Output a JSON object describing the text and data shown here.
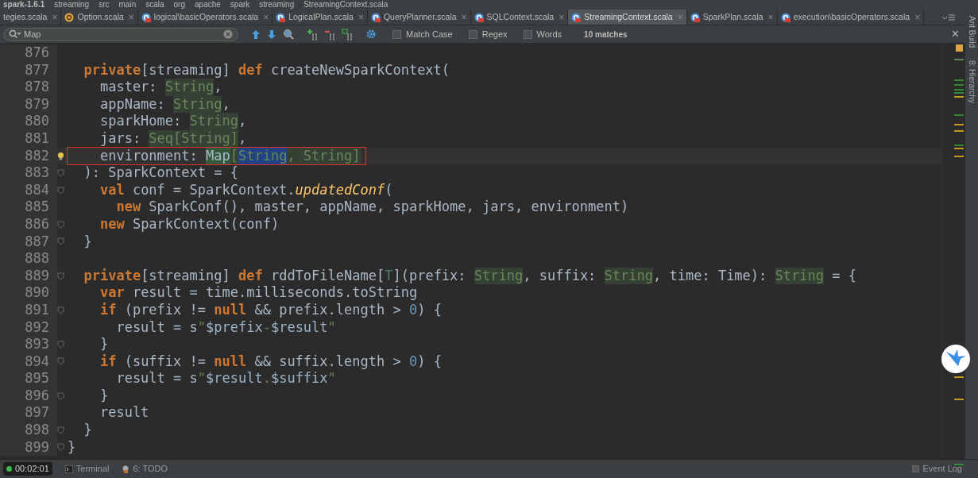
{
  "breadcrumb": [
    "spark-1.6.1",
    "streaming",
    "src",
    "main",
    "scala",
    "org",
    "apache",
    "spark",
    "streaming",
    "StreamingContext.scala"
  ],
  "tabs": [
    {
      "label": "tegies.scala",
      "kind": "plain",
      "close": "×",
      "selected": false
    },
    {
      "label": "Option.scala",
      "kind": "object",
      "close": "×",
      "selected": false
    },
    {
      "label": "logical\\basicOperators.scala",
      "kind": "class",
      "close": "×",
      "selected": false
    },
    {
      "label": "LogicalPlan.scala",
      "kind": "class",
      "close": "×",
      "selected": false
    },
    {
      "label": "QueryPlanner.scala",
      "kind": "class",
      "close": "×",
      "selected": false
    },
    {
      "label": "SQLContext.scala",
      "kind": "class",
      "close": "×",
      "selected": false
    },
    {
      "label": "StreamingContext.scala",
      "kind": "class",
      "close": "×",
      "selected": true
    },
    {
      "label": "SparkPlan.scala",
      "kind": "class",
      "close": "×",
      "selected": false
    },
    {
      "label": "execution\\basicOperators.scala",
      "kind": "class",
      "close": "×",
      "selected": false
    }
  ],
  "search": {
    "value": "Map",
    "options": [
      {
        "label": "Match Case",
        "checked": false
      },
      {
        "label": "Regex",
        "checked": false
      },
      {
        "label": "Words",
        "checked": false
      }
    ],
    "matches": "10 matches",
    "close": "×"
  },
  "lines": [
    {
      "number": "876"
    },
    {
      "number": "877",
      "tokens": [
        {
          "text": "  private",
          "kind": "keyword"
        },
        {
          "text": "[streaming] ",
          "kind": "plain"
        },
        {
          "text": "def",
          "kind": "keyword"
        },
        {
          "text": " createNewSparkContext(",
          "kind": "plain"
        }
      ]
    },
    {
      "number": "878",
      "tokens": [
        {
          "text": "    master: ",
          "kind": "plain"
        },
        {
          "text": "String",
          "kind": "usage"
        },
        {
          "text": ",",
          "kind": "plain"
        }
      ]
    },
    {
      "number": "879",
      "tokens": [
        {
          "text": "    appName: ",
          "kind": "plain"
        },
        {
          "text": "String",
          "kind": "usage"
        },
        {
          "text": ",",
          "kind": "plain"
        }
      ]
    },
    {
      "number": "880",
      "tokens": [
        {
          "text": "    sparkHome: ",
          "kind": "plain"
        },
        {
          "text": "String",
          "kind": "usage"
        },
        {
          "text": ",",
          "kind": "plain"
        }
      ]
    },
    {
      "number": "881",
      "tokens": [
        {
          "text": "    jars: ",
          "kind": "plain"
        },
        {
          "text": "Seq[String]",
          "kind": "usage"
        },
        {
          "text": ",",
          "kind": "plain"
        }
      ]
    },
    {
      "number": "882",
      "current": true,
      "boxed": true,
      "bulb": true,
      "tokens": [
        {
          "text": "    environment: ",
          "kind": "plain"
        },
        {
          "text": "Map",
          "kind": "match"
        },
        {
          "text": "[",
          "kind": "usage"
        },
        {
          "text": "String",
          "kind": "selected"
        },
        {
          "text": ", String]",
          "kind": "usage"
        }
      ]
    },
    {
      "number": "883",
      "fold": true,
      "tokens": [
        {
          "text": "  ): SparkContext = {",
          "kind": "plain"
        }
      ]
    },
    {
      "number": "884",
      "fold": true,
      "tokens": [
        {
          "text": "    val",
          "kind": "keyword"
        },
        {
          "text": " conf = SparkContext.",
          "kind": "plain"
        },
        {
          "text": "updatedConf",
          "kind": "italic"
        },
        {
          "text": "(",
          "kind": "plain"
        }
      ]
    },
    {
      "number": "885",
      "tokens": [
        {
          "text": "      new",
          "kind": "keyword"
        },
        {
          "text": " SparkConf(), master, appName, sparkHome, jars, environment)",
          "kind": "plain"
        }
      ]
    },
    {
      "number": "886",
      "fold": true,
      "tokens": [
        {
          "text": "    new",
          "kind": "keyword"
        },
        {
          "text": " SparkContext(conf)",
          "kind": "plain"
        }
      ]
    },
    {
      "number": "887",
      "fold": true,
      "tokens": [
        {
          "text": "  }",
          "kind": "plain"
        }
      ]
    },
    {
      "number": "888"
    },
    {
      "number": "889",
      "fold": true,
      "tokens": [
        {
          "text": "  private",
          "kind": "keyword"
        },
        {
          "text": "[streaming] ",
          "kind": "plain"
        },
        {
          "text": "def",
          "kind": "keyword"
        },
        {
          "text": " rddToFileName[",
          "kind": "plain"
        },
        {
          "text": "T",
          "kind": "tparam"
        },
        {
          "text": "](prefix: ",
          "kind": "plain"
        },
        {
          "text": "String",
          "kind": "usage"
        },
        {
          "text": ", suffix: ",
          "kind": "plain"
        },
        {
          "text": "String",
          "kind": "usage"
        },
        {
          "text": ", time: Time): ",
          "kind": "plain"
        },
        {
          "text": "String",
          "kind": "usage"
        },
        {
          "text": " = {",
          "kind": "plain"
        }
      ]
    },
    {
      "number": "890",
      "tokens": [
        {
          "text": "    var",
          "kind": "keyword"
        },
        {
          "text": " result = time.milliseconds.toString",
          "kind": "plain"
        }
      ]
    },
    {
      "number": "891",
      "fold": true,
      "tokens": [
        {
          "text": "    if",
          "kind": "keyword"
        },
        {
          "text": " (prefix != ",
          "kind": "plain"
        },
        {
          "text": "null",
          "kind": "keyword"
        },
        {
          "text": " && prefix.length > ",
          "kind": "plain"
        },
        {
          "text": "0",
          "kind": "number"
        },
        {
          "text": ") {",
          "kind": "plain"
        }
      ]
    },
    {
      "number": "892",
      "tokens": [
        {
          "text": "      result = s",
          "kind": "plain"
        },
        {
          "text": "\"",
          "kind": "string"
        },
        {
          "text": "$prefix",
          "kind": "interp"
        },
        {
          "text": "-",
          "kind": "string"
        },
        {
          "text": "$result",
          "kind": "interp"
        },
        {
          "text": "\"",
          "kind": "string"
        }
      ]
    },
    {
      "number": "893",
      "fold": true,
      "tokens": [
        {
          "text": "    }",
          "kind": "plain"
        }
      ]
    },
    {
      "number": "894",
      "fold": true,
      "tokens": [
        {
          "text": "    if",
          "kind": "keyword"
        },
        {
          "text": " (suffix != ",
          "kind": "plain"
        },
        {
          "text": "null",
          "kind": "keyword"
        },
        {
          "text": " && suffix.length > ",
          "kind": "plain"
        },
        {
          "text": "0",
          "kind": "number"
        },
        {
          "text": ") {",
          "kind": "plain"
        }
      ]
    },
    {
      "number": "895",
      "tokens": [
        {
          "text": "      result = s",
          "kind": "plain"
        },
        {
          "text": "\"",
          "kind": "string"
        },
        {
          "text": "$result",
          "kind": "interp"
        },
        {
          "text": ".",
          "kind": "string"
        },
        {
          "text": "$suffix",
          "kind": "interp"
        },
        {
          "text": "\"",
          "kind": "string"
        }
      ]
    },
    {
      "number": "896",
      "fold": true,
      "tokens": [
        {
          "text": "    }",
          "kind": "plain"
        }
      ]
    },
    {
      "number": "897",
      "tokens": [
        {
          "text": "    result",
          "kind": "plain"
        }
      ]
    },
    {
      "number": "898",
      "fold": true,
      "tokens": [
        {
          "text": "  }",
          "kind": "plain"
        }
      ]
    },
    {
      "number": "899",
      "fold": true,
      "tokens": [
        {
          "text": "}",
          "kind": "plain"
        }
      ]
    }
  ],
  "side_tools": [
    "Ant Build",
    "8: Hierarchy"
  ],
  "recorder": {
    "time": "00:02:01"
  },
  "bottom_tools": [
    {
      "label": "Terminal",
      "kind": "terminal"
    },
    {
      "label": "6: TODO",
      "kind": "todo"
    }
  ],
  "event_log": "Event Log"
}
